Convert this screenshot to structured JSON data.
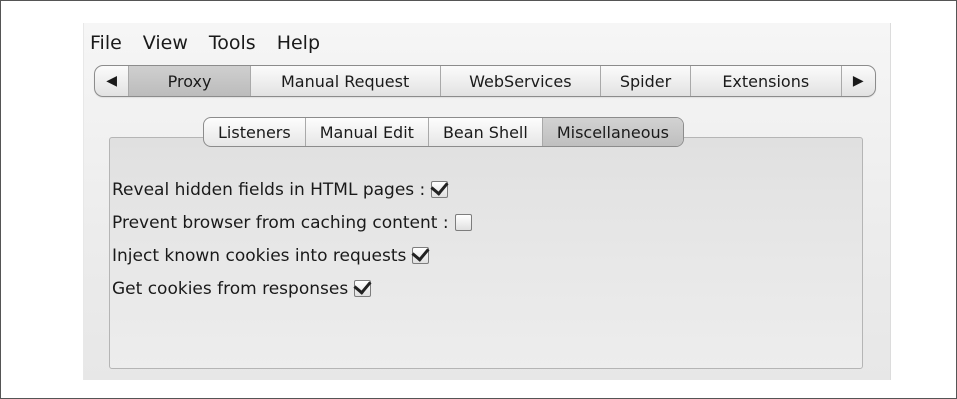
{
  "menu": [
    "File",
    "View",
    "Tools",
    "Help"
  ],
  "tabs": {
    "left_arrow_icon": "triangle-left",
    "right_arrow_icon": "triangle-right",
    "items": [
      "Proxy",
      "Manual Request",
      "WebServices",
      "Spider",
      "Extensions"
    ],
    "selected": "Proxy"
  },
  "subtabs": {
    "items": [
      "Listeners",
      "Manual Edit",
      "Bean Shell",
      "Miscellaneous"
    ],
    "selected": "Miscellaneous"
  },
  "options": [
    {
      "label": "Reveal hidden fields in HTML pages :",
      "checked": true
    },
    {
      "label": "Prevent browser from caching content :",
      "checked": false
    },
    {
      "label": "Inject known cookies into requests",
      "checked": true
    },
    {
      "label": "Get cookies from responses",
      "checked": true
    }
  ]
}
